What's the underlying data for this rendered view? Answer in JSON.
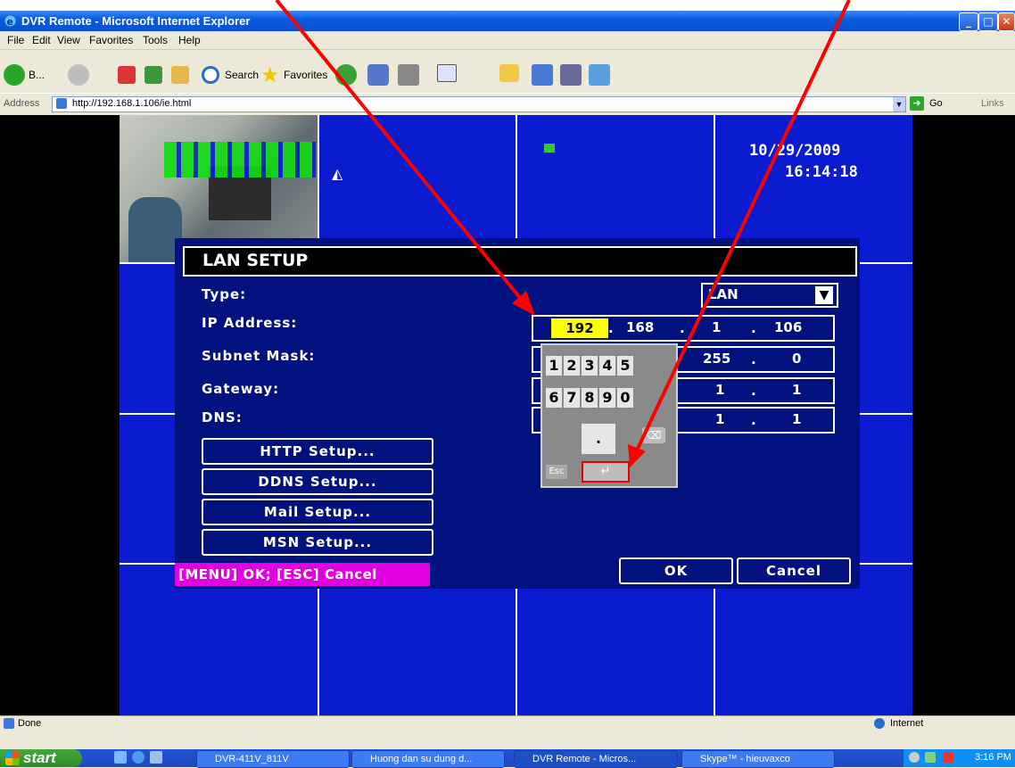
{
  "window": {
    "title": "DVR Remote - Microsoft Internet Explorer"
  },
  "menu": [
    "File",
    "Edit",
    "View",
    "Favorites",
    "Tools",
    "Help"
  ],
  "toolbar": {
    "back_label": "B...",
    "search_label": "Search",
    "favorites_label": "Favorites"
  },
  "address": {
    "label": "Address",
    "url": "http://192.168.1.106/ie.html",
    "go_label": "Go",
    "links_label": "Links"
  },
  "overlay": {
    "date": "10/29/2009",
    "time": "16:14:18"
  },
  "dialog": {
    "title": "LAN SETUP",
    "labels": {
      "type": "Type:",
      "ip": "IP Address:",
      "subnet": "Subnet Mask:",
      "gateway": "Gateway:",
      "dns": "DNS:"
    },
    "type_value": "LAN",
    "ip": [
      "192",
      "168",
      "1",
      "106"
    ],
    "subnet": [
      "255",
      "0"
    ],
    "gateway": [
      "1",
      "1"
    ],
    "dns": [
      "1",
      "1"
    ],
    "buttons": {
      "http": "HTTP Setup...",
      "ddns": "DDNS Setup...",
      "mail": "Mail Setup...",
      "msn": "MSN Setup...",
      "ok": "OK",
      "cancel": "Cancel"
    },
    "hint": "[MENU] OK; [ESC] Cancel"
  },
  "keypad": {
    "row1": [
      "1",
      "2",
      "3",
      "4",
      "5"
    ],
    "row2": [
      "6",
      "7",
      "8",
      "9",
      "0"
    ],
    "esc": "Esc"
  },
  "status": {
    "left": "Done",
    "zone": "Internet"
  },
  "taskbar": {
    "start": "start",
    "tasks": [
      "DVR-411V_811V",
      "Huong dan su dung d...",
      "DVR Remote - Micros...",
      "Skype™ - hieuvaxco"
    ],
    "clock": "3:16 PM"
  },
  "colors": {
    "dvr_blue": "#0b1cd0",
    "dialog_bg": "#01127e",
    "highlight": "#ffff00",
    "hint_bg": "#e000e0",
    "arrow": "#ff0000"
  }
}
